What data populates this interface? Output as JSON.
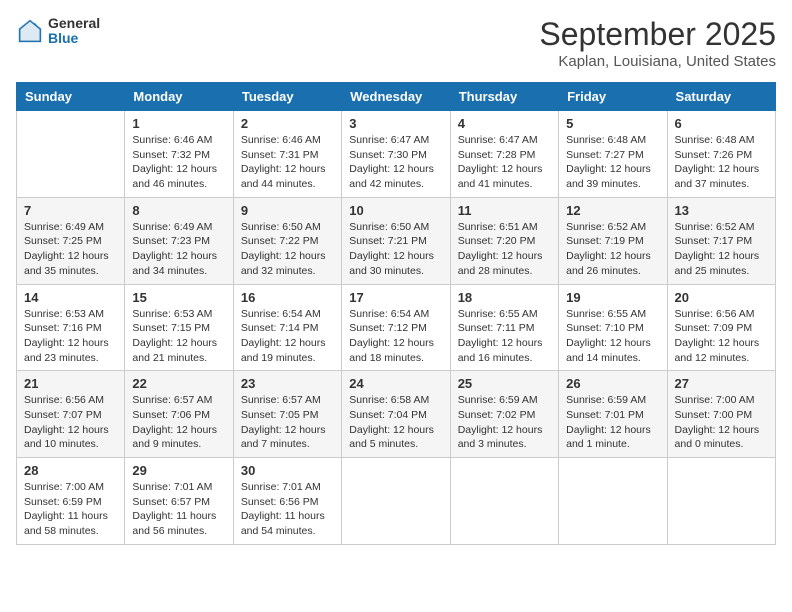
{
  "logo": {
    "general": "General",
    "blue": "Blue"
  },
  "title": "September 2025",
  "location": "Kaplan, Louisiana, United States",
  "days_of_week": [
    "Sunday",
    "Monday",
    "Tuesday",
    "Wednesday",
    "Thursday",
    "Friday",
    "Saturday"
  ],
  "weeks": [
    [
      {
        "day": "",
        "info": ""
      },
      {
        "day": "1",
        "info": "Sunrise: 6:46 AM\nSunset: 7:32 PM\nDaylight: 12 hours\nand 46 minutes."
      },
      {
        "day": "2",
        "info": "Sunrise: 6:46 AM\nSunset: 7:31 PM\nDaylight: 12 hours\nand 44 minutes."
      },
      {
        "day": "3",
        "info": "Sunrise: 6:47 AM\nSunset: 7:30 PM\nDaylight: 12 hours\nand 42 minutes."
      },
      {
        "day": "4",
        "info": "Sunrise: 6:47 AM\nSunset: 7:28 PM\nDaylight: 12 hours\nand 41 minutes."
      },
      {
        "day": "5",
        "info": "Sunrise: 6:48 AM\nSunset: 7:27 PM\nDaylight: 12 hours\nand 39 minutes."
      },
      {
        "day": "6",
        "info": "Sunrise: 6:48 AM\nSunset: 7:26 PM\nDaylight: 12 hours\nand 37 minutes."
      }
    ],
    [
      {
        "day": "7",
        "info": "Sunrise: 6:49 AM\nSunset: 7:25 PM\nDaylight: 12 hours\nand 35 minutes."
      },
      {
        "day": "8",
        "info": "Sunrise: 6:49 AM\nSunset: 7:23 PM\nDaylight: 12 hours\nand 34 minutes."
      },
      {
        "day": "9",
        "info": "Sunrise: 6:50 AM\nSunset: 7:22 PM\nDaylight: 12 hours\nand 32 minutes."
      },
      {
        "day": "10",
        "info": "Sunrise: 6:50 AM\nSunset: 7:21 PM\nDaylight: 12 hours\nand 30 minutes."
      },
      {
        "day": "11",
        "info": "Sunrise: 6:51 AM\nSunset: 7:20 PM\nDaylight: 12 hours\nand 28 minutes."
      },
      {
        "day": "12",
        "info": "Sunrise: 6:52 AM\nSunset: 7:19 PM\nDaylight: 12 hours\nand 26 minutes."
      },
      {
        "day": "13",
        "info": "Sunrise: 6:52 AM\nSunset: 7:17 PM\nDaylight: 12 hours\nand 25 minutes."
      }
    ],
    [
      {
        "day": "14",
        "info": "Sunrise: 6:53 AM\nSunset: 7:16 PM\nDaylight: 12 hours\nand 23 minutes."
      },
      {
        "day": "15",
        "info": "Sunrise: 6:53 AM\nSunset: 7:15 PM\nDaylight: 12 hours\nand 21 minutes."
      },
      {
        "day": "16",
        "info": "Sunrise: 6:54 AM\nSunset: 7:14 PM\nDaylight: 12 hours\nand 19 minutes."
      },
      {
        "day": "17",
        "info": "Sunrise: 6:54 AM\nSunset: 7:12 PM\nDaylight: 12 hours\nand 18 minutes."
      },
      {
        "day": "18",
        "info": "Sunrise: 6:55 AM\nSunset: 7:11 PM\nDaylight: 12 hours\nand 16 minutes."
      },
      {
        "day": "19",
        "info": "Sunrise: 6:55 AM\nSunset: 7:10 PM\nDaylight: 12 hours\nand 14 minutes."
      },
      {
        "day": "20",
        "info": "Sunrise: 6:56 AM\nSunset: 7:09 PM\nDaylight: 12 hours\nand 12 minutes."
      }
    ],
    [
      {
        "day": "21",
        "info": "Sunrise: 6:56 AM\nSunset: 7:07 PM\nDaylight: 12 hours\nand 10 minutes."
      },
      {
        "day": "22",
        "info": "Sunrise: 6:57 AM\nSunset: 7:06 PM\nDaylight: 12 hours\nand 9 minutes."
      },
      {
        "day": "23",
        "info": "Sunrise: 6:57 AM\nSunset: 7:05 PM\nDaylight: 12 hours\nand 7 minutes."
      },
      {
        "day": "24",
        "info": "Sunrise: 6:58 AM\nSunset: 7:04 PM\nDaylight: 12 hours\nand 5 minutes."
      },
      {
        "day": "25",
        "info": "Sunrise: 6:59 AM\nSunset: 7:02 PM\nDaylight: 12 hours\nand 3 minutes."
      },
      {
        "day": "26",
        "info": "Sunrise: 6:59 AM\nSunset: 7:01 PM\nDaylight: 12 hours\nand 1 minute."
      },
      {
        "day": "27",
        "info": "Sunrise: 7:00 AM\nSunset: 7:00 PM\nDaylight: 12 hours\nand 0 minutes."
      }
    ],
    [
      {
        "day": "28",
        "info": "Sunrise: 7:00 AM\nSunset: 6:59 PM\nDaylight: 11 hours\nand 58 minutes."
      },
      {
        "day": "29",
        "info": "Sunrise: 7:01 AM\nSunset: 6:57 PM\nDaylight: 11 hours\nand 56 minutes."
      },
      {
        "day": "30",
        "info": "Sunrise: 7:01 AM\nSunset: 6:56 PM\nDaylight: 11 hours\nand 54 minutes."
      },
      {
        "day": "",
        "info": ""
      },
      {
        "day": "",
        "info": ""
      },
      {
        "day": "",
        "info": ""
      },
      {
        "day": "",
        "info": ""
      }
    ]
  ]
}
